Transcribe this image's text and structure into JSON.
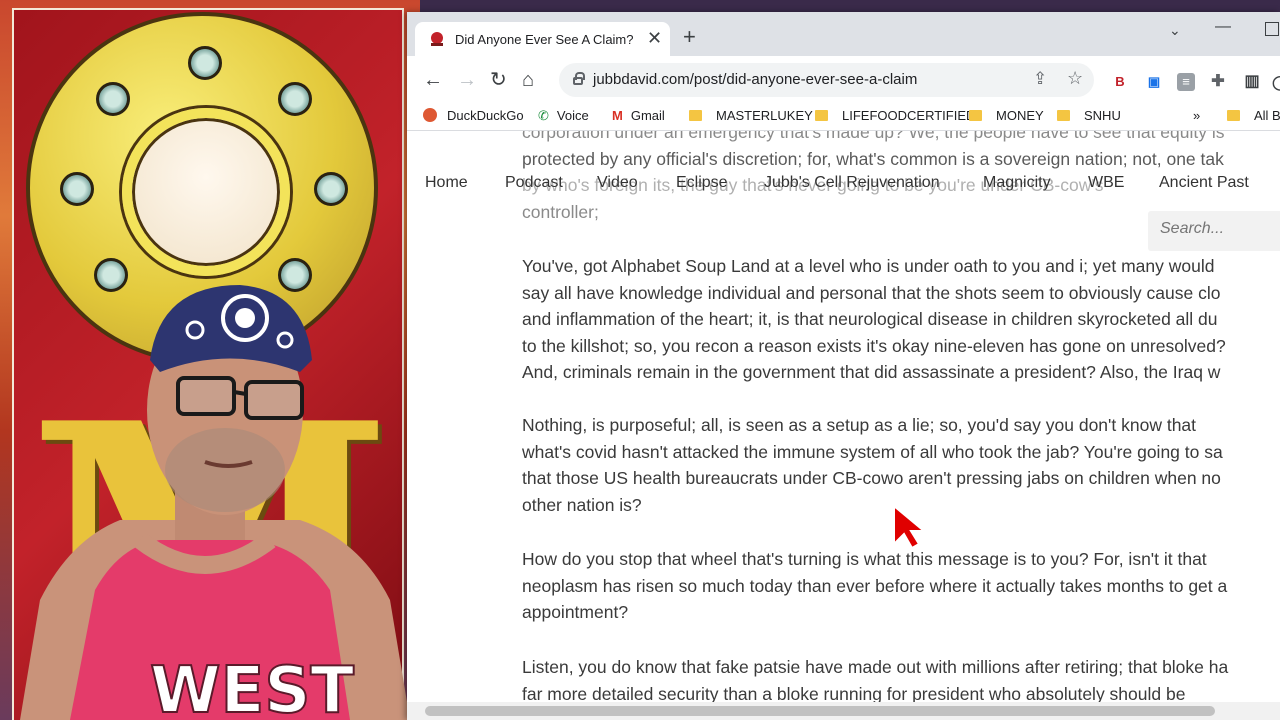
{
  "browser": {
    "tab_title": "Did Anyone Ever See A Claim?",
    "url": "jubbdavid.com/post/did-anyone-ever-see-a-claim",
    "bookmarks": [
      "DuckDuckGo",
      "Voice",
      "Gmail",
      "MASTERLUKEY",
      "LIFEFOODCERTIFIED",
      "MONEY",
      "SNHU",
      "All Bo"
    ],
    "overflow": "»"
  },
  "site": {
    "nav": [
      "Home",
      "Podcast",
      "Video",
      "Eclipse",
      "Jubb's Cell Rejuvenation",
      "Magnicity",
      "WBE",
      "Ancient Past"
    ],
    "search_placeholder": "Search..."
  },
  "article": {
    "p1": [
      "corporation under an emergency that's made up? We, the people have to see that equity is",
      "protected by any official's discretion; for, what's common is a sovereign nation; not, one tak",
      "by who's foreign its, the guy that's never going to be you're under CB-cow's",
      "controller;"
    ],
    "p2": [
      "You've, got Alphabet Soup Land at a level who is under oath to you and i; yet many would",
      "say all have knowledge individual and personal that the shots seem to obviously cause clo",
      "and inflammation of the heart; it, is that neurological disease in children skyrocketed all du",
      "to the killshot; so, you recon a reason exists it's okay nine-eleven has gone on unresolved?",
      "And, criminals remain in the government that did assassinate a president? Also, the Iraq w"
    ],
    "p3": [
      "Nothing, is purposeful; all, is seen as a setup as a lie; so, you'd say you don't know that",
      "what's covid hasn't attacked the immune system of all who took the jab? You're going to sa",
      "that those US health bureaucrats under CB-cowo aren't pressing jabs on children when no",
      "other nation is?"
    ],
    "p4": [
      "How do you stop that wheel that's turning is what this message is to you? For, isn't it that",
      "neoplasm has risen so much today than ever before where it actually takes months to get a",
      "appointment?"
    ],
    "p5": [
      "Listen, you do know that fake patsie have made out with millions after retiring; that bloke ha",
      "far more detailed security than a bloke running for president who absolutely should be"
    ]
  },
  "overlay": {
    "logo_letter": "M",
    "shirt_text": "WEST"
  },
  "colors": {
    "accent_red": "#c2222a",
    "gold": "#e3c93b",
    "shirt_pink": "#e43b6a",
    "cursor_red": "#e00000"
  }
}
